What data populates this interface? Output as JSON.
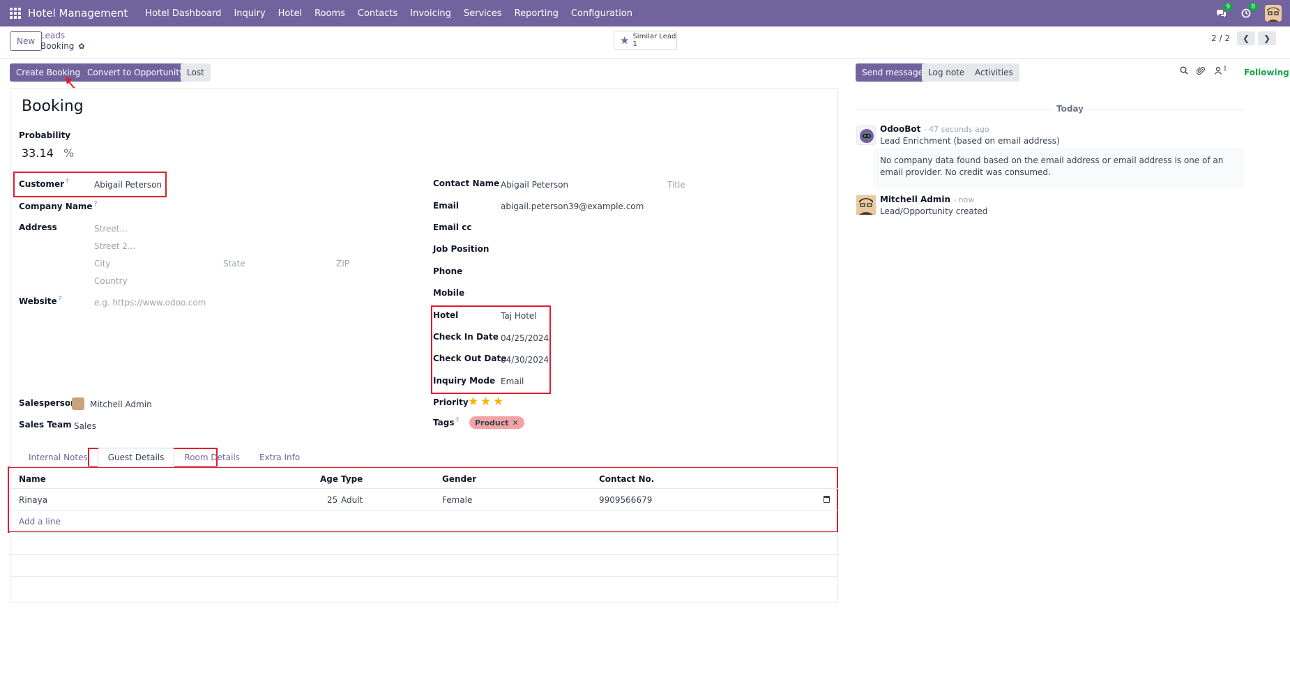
{
  "navbar": {
    "app_name": "Hotel Management",
    "menu": [
      "Hotel Dashboard",
      "Inquiry",
      "Hotel",
      "Rooms",
      "Contacts",
      "Invoicing",
      "Services",
      "Reporting",
      "Configuration"
    ],
    "messages_badge": "9",
    "activities_badge": "8"
  },
  "control_panel": {
    "new_label": "New",
    "breadcrumb_parent": "Leads",
    "breadcrumb_current": "Booking",
    "similar_label": "Similar Lead",
    "similar_count": "1",
    "pager": "2 / 2"
  },
  "actions": {
    "create_booking": "Create Booking",
    "convert": "Convert to Opportunity",
    "lost": "Lost"
  },
  "form": {
    "title": "Booking",
    "probability_label": "Probability",
    "probability_value": "33.14",
    "probability_unit": "%",
    "customer_label": "Customer",
    "customer_value": "Abigail Peterson",
    "company_label": "Company Name",
    "address_label": "Address",
    "street_ph": "Street...",
    "street2_ph": "Street 2...",
    "city_ph": "City",
    "state_ph": "State",
    "zip_ph": "ZIP",
    "country_ph": "Country",
    "website_label": "Website",
    "website_ph": "e.g. https://www.odoo.com",
    "salesperson_label": "Salesperson",
    "salesperson_value": "Mitchell Admin",
    "sales_team_label": "Sales Team",
    "sales_team_value": "Sales",
    "contact_name_label": "Contact Name",
    "contact_name_value": "Abigail Peterson",
    "title_ph": "Title",
    "email_label": "Email",
    "email_value": "abigail.peterson39@example.com",
    "email_cc_label": "Email cc",
    "job_position_label": "Job Position",
    "phone_label": "Phone",
    "mobile_label": "Mobile",
    "hotel_label": "Hotel",
    "hotel_value": "Taj Hotel",
    "check_in_label": "Check In Date",
    "check_in_value": "04/25/2024",
    "check_out_label": "Check Out Date",
    "check_out_value": "04/30/2024",
    "inquiry_mode_label": "Inquiry Mode",
    "inquiry_mode_value": "Email",
    "priority_label": "Priority",
    "priority_stars": 3,
    "tags_label": "Tags",
    "tag_value": "Product",
    "help_mark": "?"
  },
  "tabs": [
    "Internal Notes",
    "Guest Details",
    "Room Details",
    "Extra Info"
  ],
  "guest_table": {
    "headers": [
      "Name",
      "Age",
      "Type",
      "Gender",
      "Contact No."
    ],
    "rows": [
      {
        "name": "Rinaya",
        "age": "25",
        "type": "Adult",
        "gender": "Female",
        "contact": "9909566679"
      }
    ],
    "add_line": "Add a line"
  },
  "chatter": {
    "send_message": "Send message",
    "log_note": "Log note",
    "activities": "Activities",
    "followers_count": "1",
    "following": "Following",
    "date_separator": "Today",
    "messages": [
      {
        "author": "OdooBot",
        "time": "- 47 seconds ago",
        "text": "Lead Enrichment (based on email address)",
        "note": "No company data found based on the email address or email address is one of an email provider. No credit was consumed."
      },
      {
        "author": "Mitchell Admin",
        "time": "- now",
        "text": "Lead/Opportunity created"
      }
    ]
  },
  "colors": {
    "brand": "#71639e",
    "highlight": "#e11d2c",
    "star": "#f3b700",
    "following": "#17a34a",
    "tag": "#f4a3a3"
  }
}
